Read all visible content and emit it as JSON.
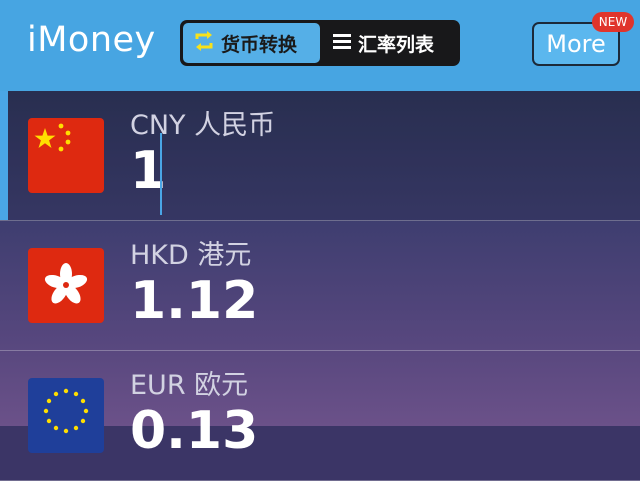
{
  "app": {
    "title": "iMoney"
  },
  "tabs": [
    {
      "label": "货币转换",
      "icon": "swap-icon",
      "active": true
    },
    {
      "label": "汇率列表",
      "icon": "list-icon",
      "active": false
    }
  ],
  "header": {
    "more_label": "More",
    "badge": "NEW"
  },
  "currencies": [
    {
      "label": "CNY 人民币",
      "value": "1",
      "flag": "china-flag",
      "active": true
    },
    {
      "label": "HKD 港元",
      "value": "1.12",
      "flag": "hong-kong-flag",
      "active": false
    },
    {
      "label": "EUR 欧元",
      "value": "0.13",
      "flag": "eu-flag",
      "active": false
    }
  ],
  "colors": {
    "header": "#47a5e2",
    "accent": "#4aa6e6",
    "badge": "#e0352c"
  }
}
